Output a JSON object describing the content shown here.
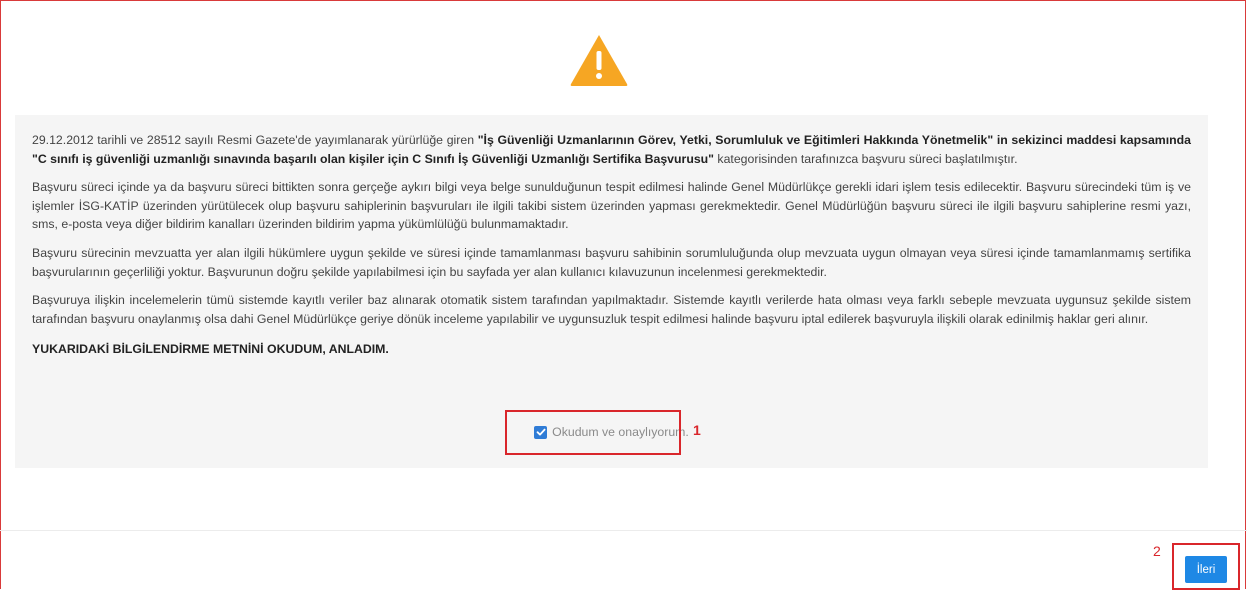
{
  "colors": {
    "warning": "#f6a623",
    "panel_bg": "#f5f5f5",
    "primary": "#1e88e5",
    "highlight": "#d9262b"
  },
  "warning_icon": "warning-triangle-icon",
  "paragraphs": [
    {
      "p1_a": "29.12.2012 tarihli ve 28512 sayılı Resmi Gazete'de yayımlanarak yürürlüğe giren ",
      "p1_b": "\"İş Güvenliği Uzmanlarının Görev, Yetki, Sorumluluk ve Eğitimleri Hakkında Yönetmelik\" in sekizinci maddesi kapsamında \"C sınıfı iş güvenliği uzmanlığı sınavında başarılı olan kişiler için C Sınıfı İş Güvenliği Uzmanlığı Sertifika Başvurusu\"",
      "p1_c": " kategorisinden tarafınızca başvuru süreci başlatılmıştır."
    }
  ],
  "p2": "Başvuru süreci içinde ya da başvuru süreci bittikten sonra gerçeğe aykırı bilgi veya belge sunulduğunun tespit edilmesi halinde Genel Müdürlükçe gerekli idari işlem tesis edilecektir. Başvuru sürecindeki tüm iş ve işlemler İSG-KATİP üzerinden yürütülecek olup başvuru sahiplerinin başvuruları ile ilgili takibi sistem üzerinden yapması gerekmektedir. Genel Müdürlüğün başvuru süreci ile ilgili başvuru sahiplerine resmi yazı, sms, e-posta veya diğer bildirim kanalları üzerinden bildirim yapma yükümlülüğü bulunmamaktadır.",
  "p3": "Başvuru sürecinin mevzuatta yer alan ilgili hükümlere uygun şekilde ve süresi içinde tamamlanması başvuru sahibinin sorumluluğunda olup mevzuata uygun olmayan veya süresi içinde tamamlanmamış sertifika başvurularının geçerliliği yoktur. Başvurunun doğru şekilde yapılabilmesi için bu sayfada yer alan kullanıcı kılavuzunun incelenmesi gerekmektedir.",
  "p4": "Başvuruya ilişkin incelemelerin tümü sistemde kayıtlı veriler baz alınarak otomatik sistem tarafından yapılmaktadır. Sistemde kayıtlı verilerde hata olması veya farklı sebeple mevzuata uygunsuz şekilde sistem tarafından başvuru onaylanmış olsa dahi Genel Müdürlükçe geriye dönük inceleme yapılabilir ve uygunsuzluk tespit edilmesi halinde başvuru iptal edilerek başvuruyla ilişkili olarak edinilmiş haklar geri alınır.",
  "acknowledgement": "YUKARIDAKİ BİLGİLENDİRME METNİNİ OKUDUM, ANLADIM.",
  "consent": {
    "label": "Okudum ve onaylıyorum.",
    "checked": true
  },
  "annotations": {
    "step1": "1",
    "step2": "2"
  },
  "next_button": {
    "label": "İleri"
  }
}
